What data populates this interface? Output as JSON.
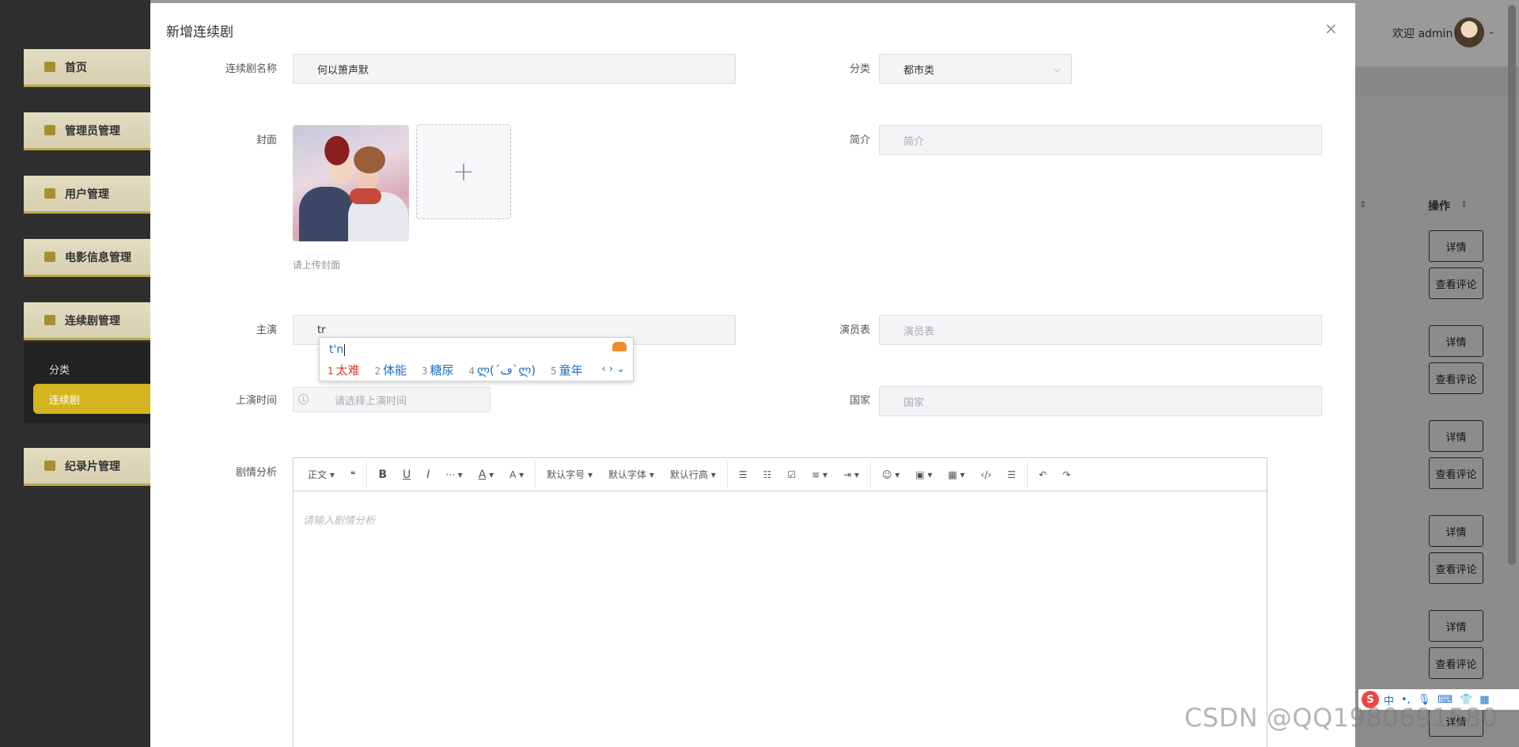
{
  "sidebar": {
    "items": [
      {
        "label": "首页"
      },
      {
        "label": "管理员管理"
      },
      {
        "label": "用户管理"
      },
      {
        "label": "电影信息管理"
      },
      {
        "label": "连续剧管理"
      },
      {
        "label": "纪录片管理"
      }
    ],
    "submenu": {
      "category": "分类",
      "series": "连续剧"
    }
  },
  "header": {
    "welcome": "欢迎 admin"
  },
  "table": {
    "op_header": "操作",
    "rows": [
      {
        "detail": "详情",
        "comments": "查看评论"
      },
      {
        "detail": "详情",
        "comments": "查看评论"
      },
      {
        "detail": "详情",
        "comments": "查看评论"
      },
      {
        "detail": "详情",
        "comments": "查看评论"
      },
      {
        "detail": "详情",
        "comments": "查看评论"
      },
      {
        "detail": "详情"
      }
    ]
  },
  "dialog": {
    "title": "新增连续剧",
    "close": "×",
    "form": {
      "name": {
        "label": "连续剧名称",
        "value": "何以箫声默"
      },
      "category": {
        "label": "分类",
        "value": "都市类"
      },
      "cover": {
        "label": "封面",
        "tip": "请上传封面",
        "plus": "+"
      },
      "intro": {
        "label": "简介",
        "placeholder": "简介"
      },
      "actors": {
        "label": "主演",
        "value": "tr"
      },
      "cast": {
        "label": "演员表",
        "placeholder": "演员表"
      },
      "release": {
        "label": "上演时间",
        "placeholder": "请选择上演时间"
      },
      "country": {
        "label": "国家",
        "placeholder": "国家"
      },
      "analysis": {
        "label": "剧情分析",
        "placeholder": "请输入剧情分析"
      }
    },
    "editor_toolbar": {
      "paragraph": "正文",
      "quote": "❝",
      "bold": "B",
      "underline": "U",
      "italic": "I",
      "more": "···",
      "font_color": "A",
      "bg_color": "A",
      "font_size": "默认字号",
      "font_family": "默认字体",
      "line_height": "默认行高"
    }
  },
  "ime": {
    "pinyin": "t'n",
    "candidates": [
      {
        "n": "1",
        "text": "太难"
      },
      {
        "n": "2",
        "text": "体能"
      },
      {
        "n": "3",
        "text": "糖尿"
      },
      {
        "n": "4",
        "text": "ლ(´ڡ`ლ)"
      },
      {
        "n": "5",
        "text": "童年"
      }
    ],
    "nav": "‹ › ⌄",
    "bar": {
      "logo": "S",
      "mode": "中",
      "punct": "•,"
    }
  },
  "watermark": "CSDN @QQ1980691580"
}
